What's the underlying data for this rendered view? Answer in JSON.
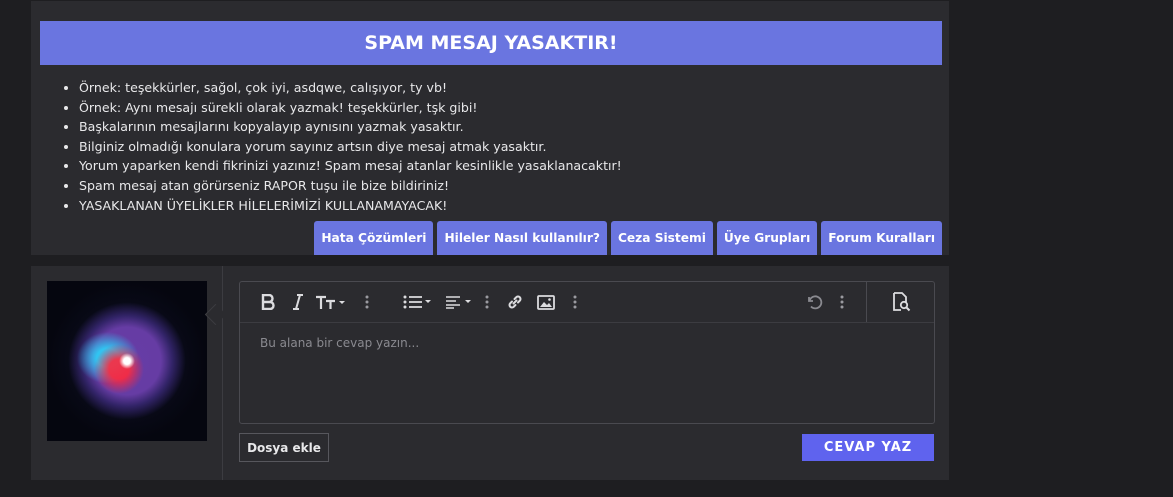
{
  "notice": {
    "banner_title": "SPAM MESAJ YASAKTIR!",
    "rules": [
      "Örnek: teşekkürler, sağol, çok iyi, asdqwe, calışıyor, ty vb!",
      "Örnek: Aynı mesajı sürekli olarak yazmak! teşekkürler, tşk gibi!",
      "Başkalarının mesajlarını kopyalayıp aynısını yazmak yasaktır.",
      "Bilginiz olmadığı konulara yorum sayınız artsın diye mesaj atmak yasaktır.",
      "Yorum yaparken kendi fikrinizi yazınız! Spam mesaj atanlar kesinlikle yasaklanacaktır!",
      "Spam mesaj atan görürseniz RAPOR tuşu ile bize bildiriniz!",
      "YASAKLANAN ÜYELİKLER HİLELERİMİZİ KULLANAMAYACAK!"
    ],
    "links": [
      "Hata Çözümleri",
      "Hileler Nasıl kullanılır?",
      "Ceza Sistemi",
      "Üye Grupları",
      "Forum Kuralları"
    ]
  },
  "reply": {
    "placeholder": "Bu alana bir cevap yazın...",
    "attach_label": "Dosya ekle",
    "submit_label": "CEVAP YAZ"
  },
  "toolbar_icons": [
    "bold-icon",
    "italic-icon",
    "text-size-icon",
    "more-options-icon",
    "list-icon",
    "align-icon",
    "more-options-icon",
    "link-icon",
    "image-icon",
    "more-options-icon",
    "undo-icon",
    "more-options-icon",
    "preview-icon"
  ],
  "colors": {
    "accent": "#6a75e0",
    "submit": "#5f63ee",
    "panel": "#2b2b2f",
    "background": "#1e1e21"
  }
}
